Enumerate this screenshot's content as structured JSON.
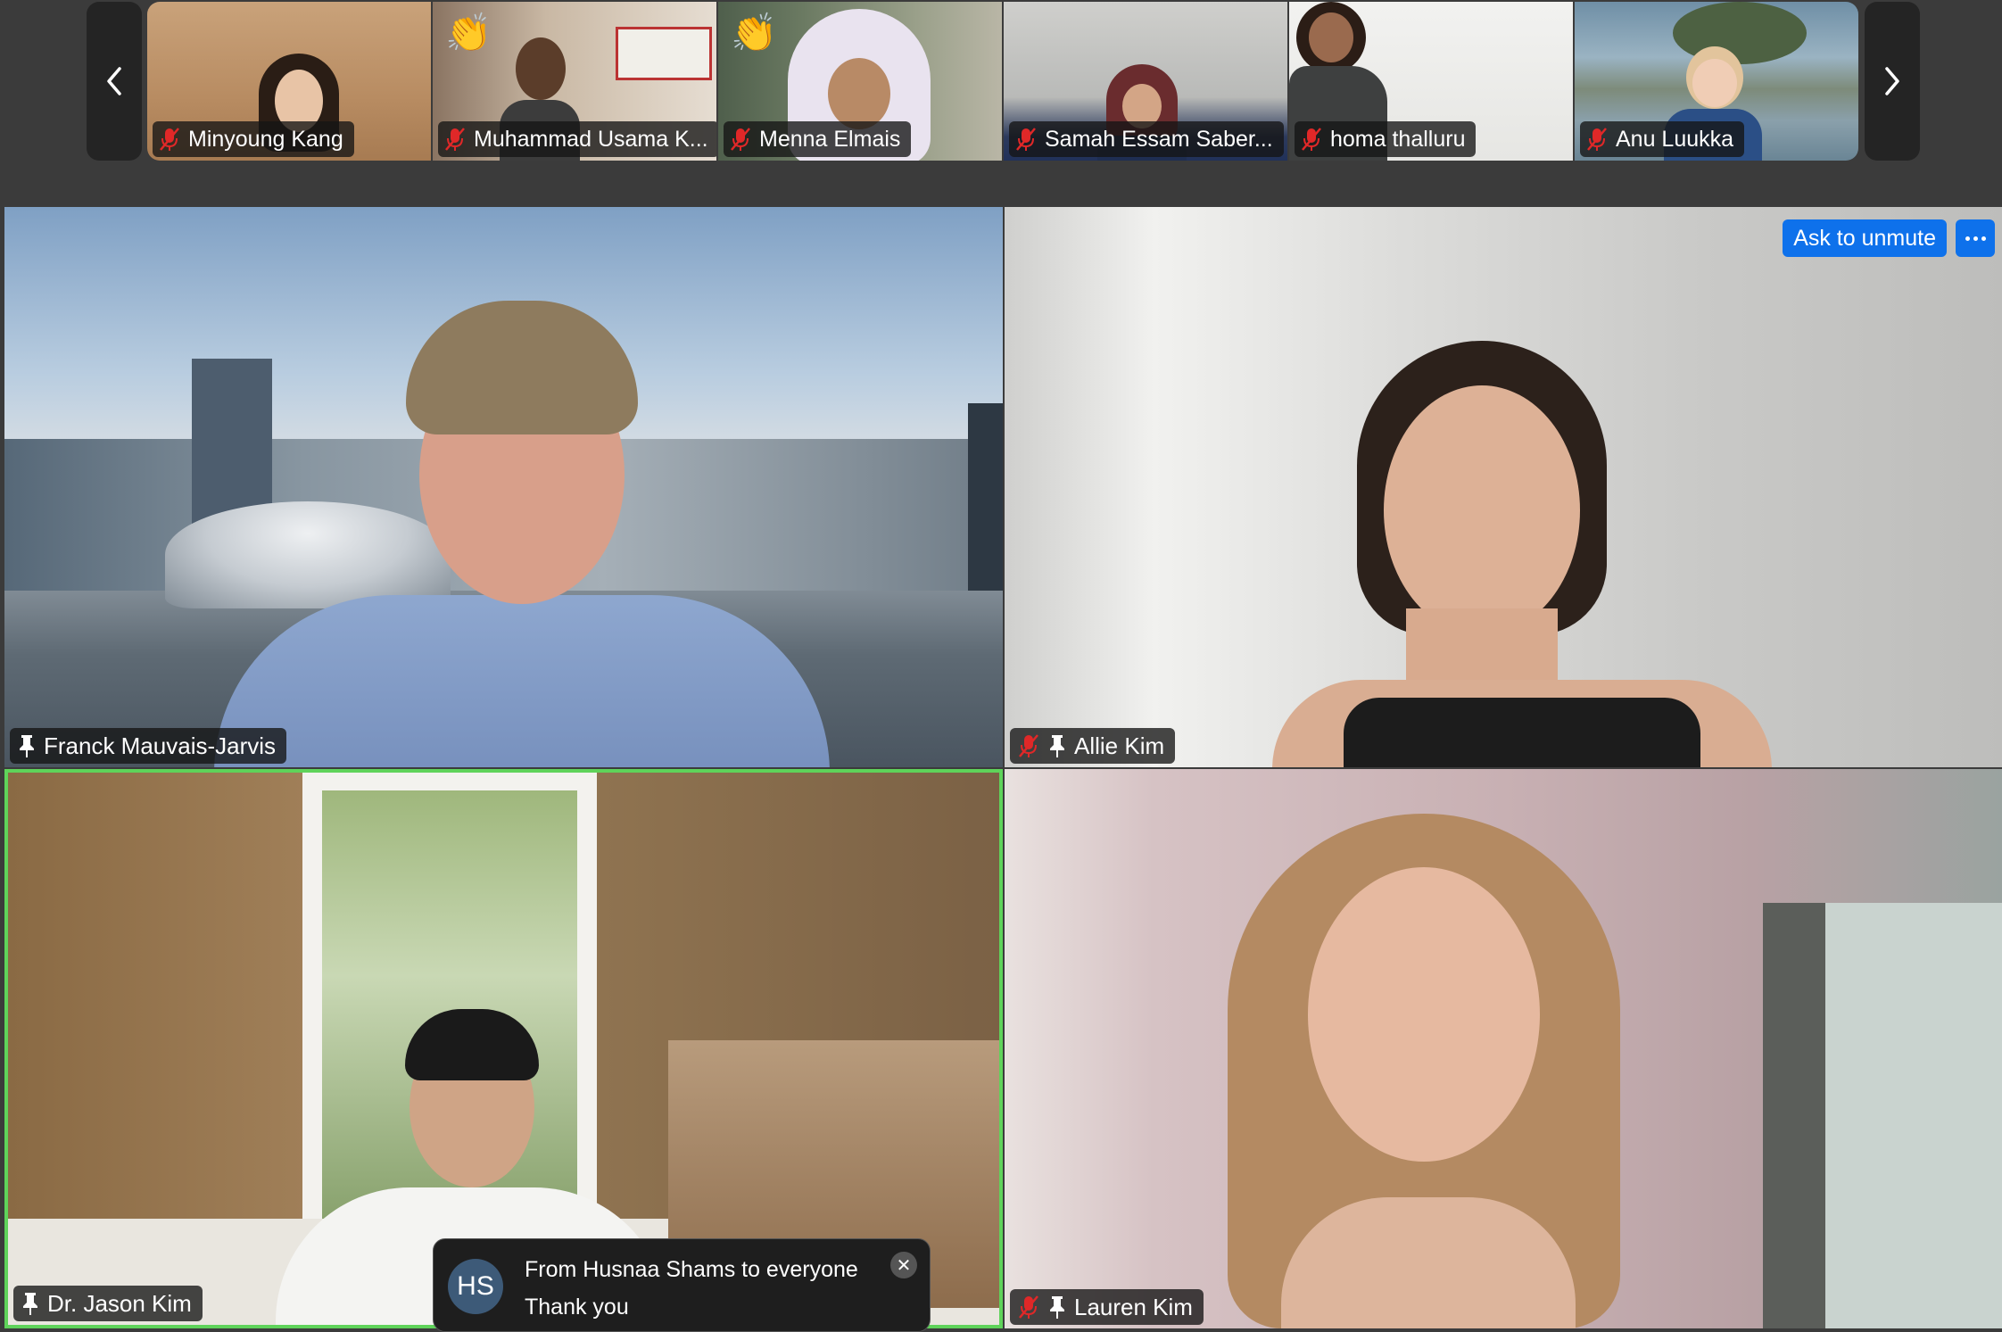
{
  "filmstrip": {
    "participants": [
      {
        "name": "Minyoung Kang",
        "muted": true,
        "reaction": ""
      },
      {
        "name": "Muhammad Usama K...",
        "muted": true,
        "reaction": "👏"
      },
      {
        "name": "Menna Elmais",
        "muted": true,
        "reaction": "👏"
      },
      {
        "name": "Samah Essam Saber...",
        "muted": true,
        "reaction": ""
      },
      {
        "name": "homa thalluru",
        "muted": true,
        "reaction": ""
      },
      {
        "name": "Anu Luukka",
        "muted": true,
        "reaction": ""
      }
    ]
  },
  "gallery": {
    "tiles": [
      {
        "name": "Franck Mauvais-Jarvis",
        "pinned": true,
        "muted": false
      },
      {
        "name": "Allie Kim",
        "pinned": true,
        "muted": true
      },
      {
        "name": "Dr. Jason Kim",
        "pinned": true,
        "muted": false,
        "active_speaker": true
      },
      {
        "name": "Lauren Kim",
        "pinned": true,
        "muted": true
      }
    ]
  },
  "ask_to_unmute": {
    "label": "Ask to unmute"
  },
  "chat_notification": {
    "avatar_initials": "HS",
    "from": "From Husnaa Shams to everyone",
    "message": "Thank you"
  },
  "colors": {
    "active_speaker_border": "#5fd35a",
    "accent_blue": "#0e71eb",
    "muted_red": "#e02828"
  }
}
